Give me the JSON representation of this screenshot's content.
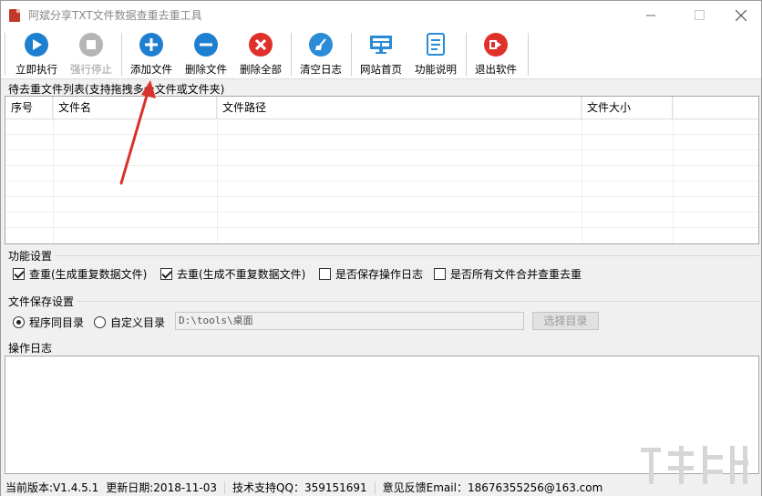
{
  "window": {
    "title": "阿斌分享TXT文件数据查重去重工具",
    "controls": [
      "minimize",
      "maximize",
      "close"
    ]
  },
  "toolbar": {
    "buttons": [
      {
        "label": "立即执行",
        "icon": "play-icon",
        "color": "#1e7fd1",
        "enabled": true
      },
      {
        "label": "强行停止",
        "icon": "stop-icon",
        "color": "#b5b5b5",
        "enabled": false
      },
      {
        "label": "添加文件",
        "icon": "plus-icon",
        "color": "#1e7fd1",
        "enabled": true
      },
      {
        "label": "删除文件",
        "icon": "minus-icon",
        "color": "#1e7fd1",
        "enabled": true
      },
      {
        "label": "删除全部",
        "icon": "x-icon",
        "color": "#e0302a",
        "enabled": true
      },
      {
        "label": "清空日志",
        "icon": "broom-icon",
        "color": "#2a8bd6",
        "enabled": true
      },
      {
        "label": "网站首页",
        "icon": "monitor-icon",
        "color": "#2a8bd6",
        "enabled": true
      },
      {
        "label": "功能说明",
        "icon": "document-icon",
        "color": "#2a8bd6",
        "enabled": true
      },
      {
        "label": "退出软件",
        "icon": "exit-icon",
        "color": "#e0302a",
        "enabled": true
      }
    ]
  },
  "file_list": {
    "label": "待去重文件列表(支持拖拽多个文件或文件夹)",
    "columns": [
      "序号",
      "文件名",
      "文件路径",
      "文件大小"
    ],
    "rows": []
  },
  "functions": {
    "label": "功能设置",
    "options": [
      {
        "label": "查重(生成重复数据文件)",
        "checked": true
      },
      {
        "label": "去重(生成不重复数据文件)",
        "checked": true
      },
      {
        "label": "是否保存操作日志",
        "checked": false
      },
      {
        "label": "是否所有文件合并查重去重",
        "checked": false
      }
    ]
  },
  "save": {
    "label": "文件保存设置",
    "options": [
      {
        "label": "程序同目录",
        "selected": true
      },
      {
        "label": "自定义目录",
        "selected": false
      }
    ],
    "path_value": "D:\\tools\\桌面",
    "choose_button": "选择目录"
  },
  "log": {
    "label": "操作日志"
  },
  "status": {
    "version": "当前版本:V1.4.5.1",
    "date": "更新日期:2018-11-03",
    "qq": "技术支持QQ：359151691",
    "feedback": "意见反馈Email：18676355256@163.com"
  },
  "annotation": {
    "arrow_color": "#d9312b"
  }
}
